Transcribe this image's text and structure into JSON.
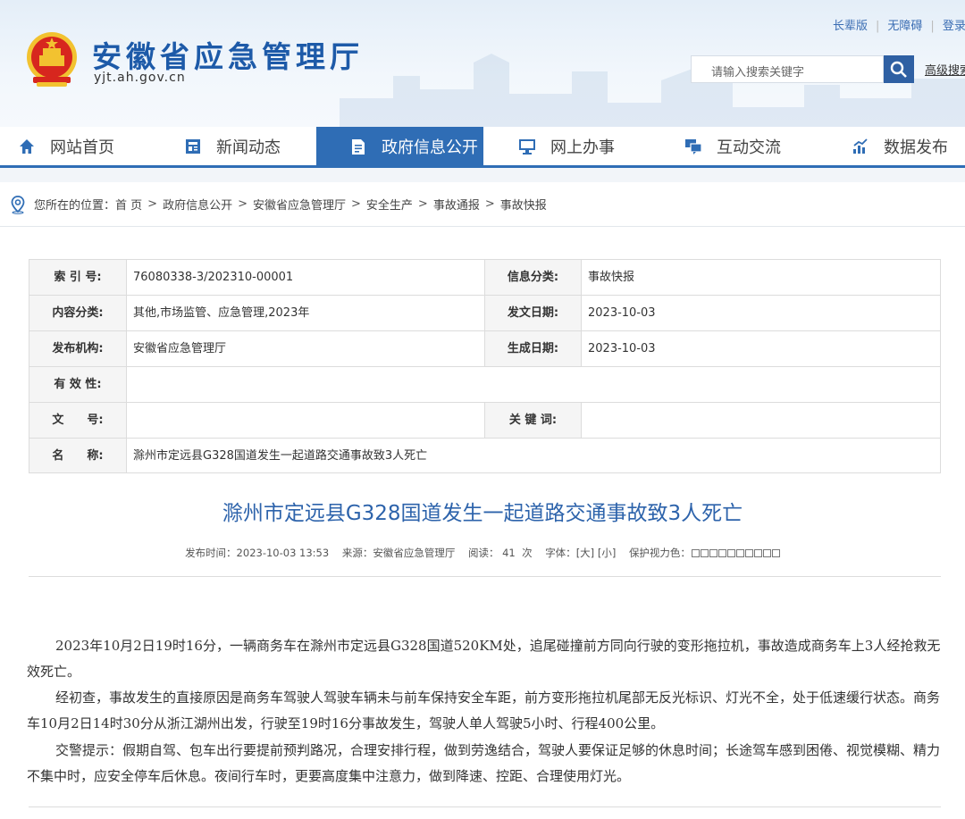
{
  "header": {
    "site_title": "安徽省应急管理厅",
    "site_domain": "yjt.ah.gov.cn",
    "top_links": [
      "长辈版",
      "无障碍",
      "登录"
    ],
    "search_placeholder": "请输入搜索关键字",
    "advanced_search": "高级搜索"
  },
  "nav": {
    "items": [
      "网站首页",
      "新闻动态",
      "政府信息公开",
      "网上办事",
      "互动交流",
      "数据发布"
    ],
    "active": "政府信息公开"
  },
  "breadcrumb": {
    "prefix": "您所在的位置：",
    "items": [
      "首 页",
      "政府信息公开",
      "安徽省应急管理厅",
      "安全生产",
      "事故通报",
      "事故快报"
    ]
  },
  "info_table": {
    "index_label": "索 引 号:",
    "index_value": "76080338-3/202310-00001",
    "category_label": "信息分类:",
    "category_value": "事故快报",
    "content_label": "内容分类:",
    "content_value": "其他,市场监管、应急管理,2023年",
    "issue_date_label": "发文日期:",
    "issue_date_value": "2023-10-03",
    "org_label": "发布机构:",
    "org_value": "安徽省应急管理厅",
    "created_label": "生成日期:",
    "created_value": "2023-10-03",
    "valid_label": "有 效 性:",
    "valid_value": "",
    "docno_label": "文　　号:",
    "docno_value": "",
    "keywords_label": "关 键 词:",
    "keywords_value": "",
    "name_label": "名　　称:",
    "name_value": "滁州市定远县G328国道发生一起道路交通事故致3人死亡"
  },
  "article": {
    "title": "滁州市定远县G328国道发生一起道路交通事故致3人死亡",
    "meta": {
      "publish_time": "发布时间：2023-10-03 13:53",
      "source": "来源：安徽省应急管理厅",
      "reads_label": "阅读：",
      "reads": "41",
      "reads_unit": "次",
      "font_label": "字体：",
      "font_large": "[大]",
      "font_small": "[小]",
      "eye_label": "保护视力色："
    },
    "paragraphs": [
      "2023年10月2日19时16分，一辆商务车在滁州市定远县G328国道520KM处，追尾碰撞前方同向行驶的变形拖拉机，事故造成商务车上3人经抢救无效死亡。",
      "经初查，事故发生的直接原因是商务车驾驶人驾驶车辆未与前车保持安全车距，前方变形拖拉机尾部无反光标识、灯光不全，处于低速缓行状态。商务车10月2日14时30分从浙江湖州出发，行驶至19时16分事故发生，驾驶人单人驾驶5小时、行程400公里。",
      "交警提示：假期自驾、包车出行要提前预判路况，合理安排行程，做到劳逸结合，驾驶人要保证足够的休息时间；长途驾车感到困倦、视觉模糊、精力不集中时，应安全停车后休息。夜间行车时，更要高度集中注意力，做到降速、控距、合理使用灯光。"
    ]
  },
  "colors": {
    "brand_blue": "#2f6db5",
    "title_blue": "#2d63ab",
    "emblem_red": "#d7261e",
    "emblem_gold": "#f2c230"
  }
}
